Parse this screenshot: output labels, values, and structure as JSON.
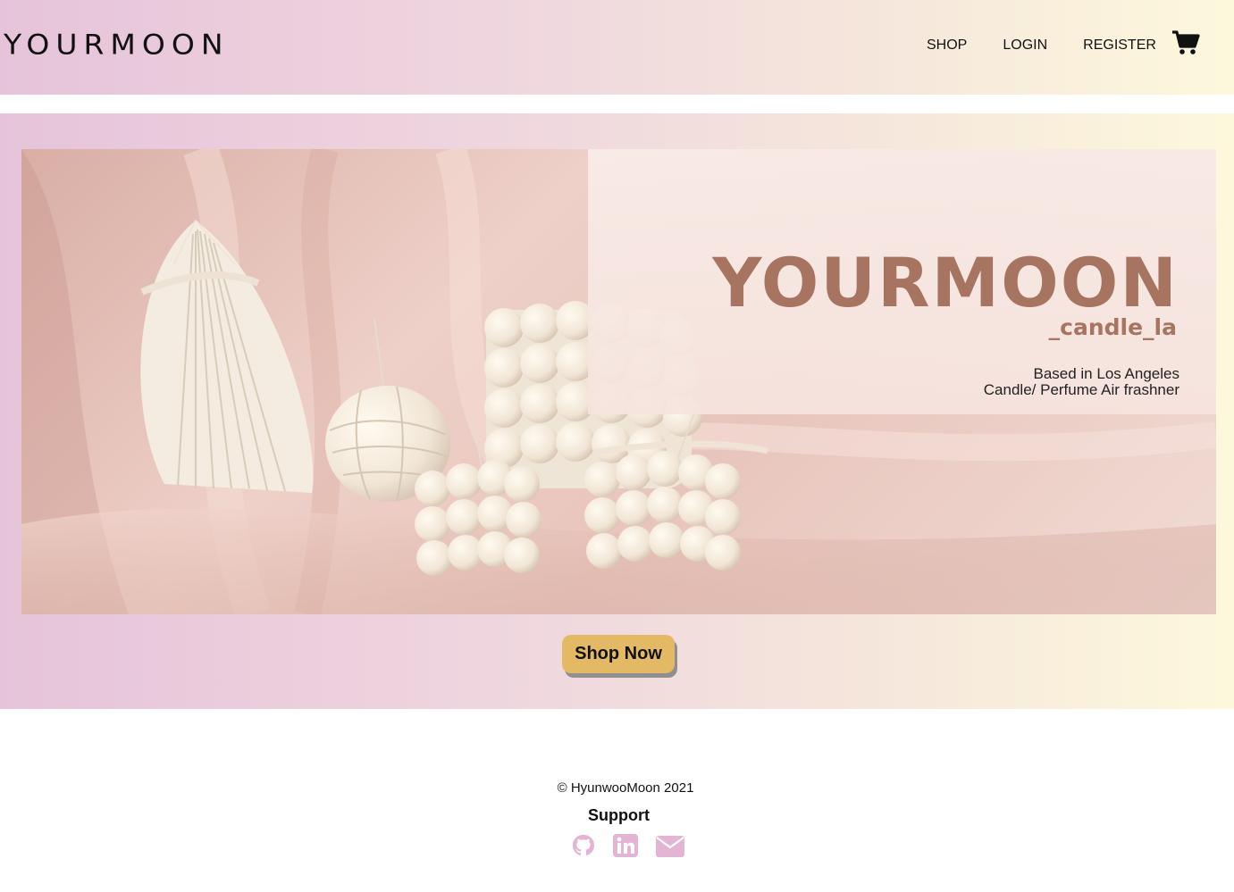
{
  "navbar": {
    "brand": "YOURMOON",
    "links": [
      "SHOP",
      "LOGIN",
      "REGISTER"
    ],
    "cart_icon": "shopping-cart-icon"
  },
  "hero": {
    "banner": {
      "title": "YOURMOON",
      "subtitle": "_candle_la",
      "line1": "Based in Los Angeles",
      "line2": "Candle/ Perfume Air frashner"
    },
    "cta_label": "Shop Now"
  },
  "footer": {
    "copyright": "© HyunwooMoon 2021",
    "support_label": "Support",
    "icons": [
      "github-icon",
      "linkedin-icon",
      "email-icon"
    ],
    "icon_color": "#e3b4d4"
  },
  "colors": {
    "gradient_start": "#e6c3da",
    "gradient_end": "#fdf8dc",
    "button": "#e4b965",
    "banner_text": "#a87462"
  }
}
